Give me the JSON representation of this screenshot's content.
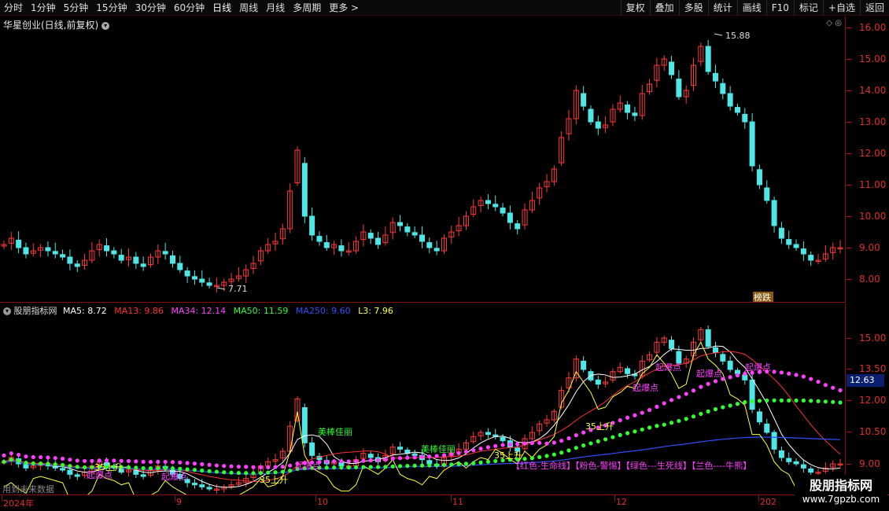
{
  "toolbar": {
    "left": [
      "分时",
      "1分钟",
      "5分钟",
      "15分钟",
      "30分钟",
      "60分钟",
      "日线",
      "周线",
      "月线",
      "多周期",
      "更多 >"
    ],
    "right": [
      "复权",
      "叠加",
      "多股",
      "统计",
      "画线",
      "F10",
      "标记",
      "+自选",
      "返回"
    ]
  },
  "main": {
    "title": "华星创业(日线,前复权)",
    "high_label": "15.88",
    "low_label": "7.71",
    "event_label": "榜跌",
    "y_labels": [
      "16.00",
      "15.00",
      "14.00",
      "13.00",
      "12.00",
      "11.00",
      "10.00",
      "9.00",
      "8.00"
    ]
  },
  "sub": {
    "name": "股朋指标网",
    "ma5": "MA5: 8.72",
    "ma13": "MA13: 9.86",
    "ma34": "MA34: 12.14",
    "ma50": "MA50: 11.59",
    "ma250": "MA250: 9.60",
    "l3": "L3: 7.96",
    "y_labels": [
      "15.00",
      "13.50",
      "12.00",
      "10.50",
      "9.00"
    ],
    "current_value": "12.63",
    "legend": "【红色-生命线】【粉色-警惕】【绿色---生死线】【兰色----牛熊】",
    "annotations": [
      "起爆点",
      "起爆点",
      "起爆点",
      "起爆点",
      "起爆点",
      "起爆点",
      "起爆点",
      "35上升",
      "35上升",
      "35上升",
      "35上升",
      "美棒佳丽",
      "美棒佳丽"
    ]
  },
  "dates": [
    "2024年",
    "9",
    "10",
    "11",
    "12",
    "202"
  ],
  "future_text": "用到未来数据",
  "watermark": {
    "line1": "股朋指标网",
    "line2": "www.7gpzb.com"
  },
  "colors": {
    "up": "#ff3a3a",
    "down": "#4ee6e6",
    "ma5": "#ffffff",
    "ma13": "#ff3030",
    "ma34": "#ff40ff",
    "ma50": "#30ff30",
    "ma250": "#3050ff",
    "l3": "#ffff40"
  },
  "chart_data": {
    "type": "candlestick",
    "series_close": [
      9.1,
      9.3,
      9.0,
      8.8,
      8.9,
      9.0,
      8.9,
      8.8,
      8.7,
      8.5,
      8.4,
      8.6,
      8.9,
      9.1,
      8.9,
      8.8,
      8.6,
      8.7,
      8.5,
      8.4,
      8.7,
      8.9,
      8.8,
      8.5,
      8.3,
      8.1,
      8.0,
      7.9,
      7.8,
      7.8,
      7.9,
      8.0,
      8.1,
      8.3,
      8.5,
      8.9,
      9.1,
      9.2,
      9.6,
      10.8,
      12.1,
      10.0,
      9.4,
      9.2,
      9.0,
      9.1,
      8.9,
      8.9,
      9.2,
      9.5,
      9.3,
      9.1,
      9.4,
      9.8,
      9.7,
      9.5,
      9.4,
      9.2,
      9.0,
      8.9,
      9.3,
      9.5,
      9.7,
      10.0,
      10.3,
      10.5,
      10.4,
      10.3,
      10.1,
      9.8,
      9.6,
      10.2,
      10.5,
      10.9,
      11.1,
      11.5,
      12.5,
      13.1,
      14.0,
      13.5,
      13.0,
      12.8,
      12.9,
      13.4,
      13.6,
      13.3,
      13.2,
      13.9,
      14.2,
      14.8,
      15.0,
      14.5,
      13.8,
      14.0,
      14.8,
      15.4,
      14.6,
      14.3,
      13.9,
      13.5,
      13.3,
      13.0,
      11.6,
      11.0,
      10.5,
      9.7,
      9.3,
      9.1,
      9.0,
      8.8,
      8.6,
      8.6,
      8.8,
      9.0,
      9.0
    ]
  }
}
